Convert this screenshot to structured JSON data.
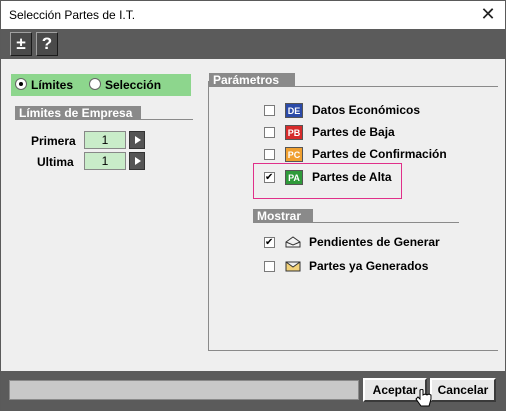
{
  "window": {
    "title": "Selección Partes de I.T.",
    "close_glyph": "✕"
  },
  "toolbar": {
    "btn1_glyph": "±",
    "btn2_glyph": "?"
  },
  "mode": {
    "opt1": "Límites",
    "opt2": "Selección",
    "selected": "Límites"
  },
  "limites": {
    "header": "Límites de Empresa",
    "primera_label": "Primera",
    "primera_value": "1",
    "ultima_label": "Ultima",
    "ultima_value": "1"
  },
  "parametros": {
    "header": "Parámetros",
    "items": [
      {
        "label": "Datos Económicos",
        "badge": "DE",
        "checked": false,
        "badge_bg": "#2b4aa8",
        "badge_fg": "#ffffff"
      },
      {
        "label": "Partes de Baja",
        "badge": "PB",
        "checked": false,
        "badge_bg": "#d62b2b",
        "badge_fg": "#ffffff"
      },
      {
        "label": "Partes de Confirmación",
        "badge": "PC",
        "checked": false,
        "badge_bg": "#f0a030",
        "badge_fg": "#ffffff"
      },
      {
        "label": "Partes de Alta",
        "badge": "PA",
        "checked": true,
        "badge_bg": "#2f9a3a",
        "badge_fg": "#ffffff"
      }
    ]
  },
  "mostrar": {
    "header": "Mostrar",
    "items": [
      {
        "label": "Pendientes de Generar",
        "icon": "open-envelope-icon",
        "checked": true
      },
      {
        "label": "Partes ya Generados",
        "icon": "closed-envelope-icon",
        "checked": false
      }
    ]
  },
  "footer": {
    "accept": "Aceptar",
    "cancel": "Cancelar"
  },
  "colors": {
    "accent_green": "#8dd68d",
    "field_green": "#c9ecc9",
    "highlight": "#e0308a"
  }
}
